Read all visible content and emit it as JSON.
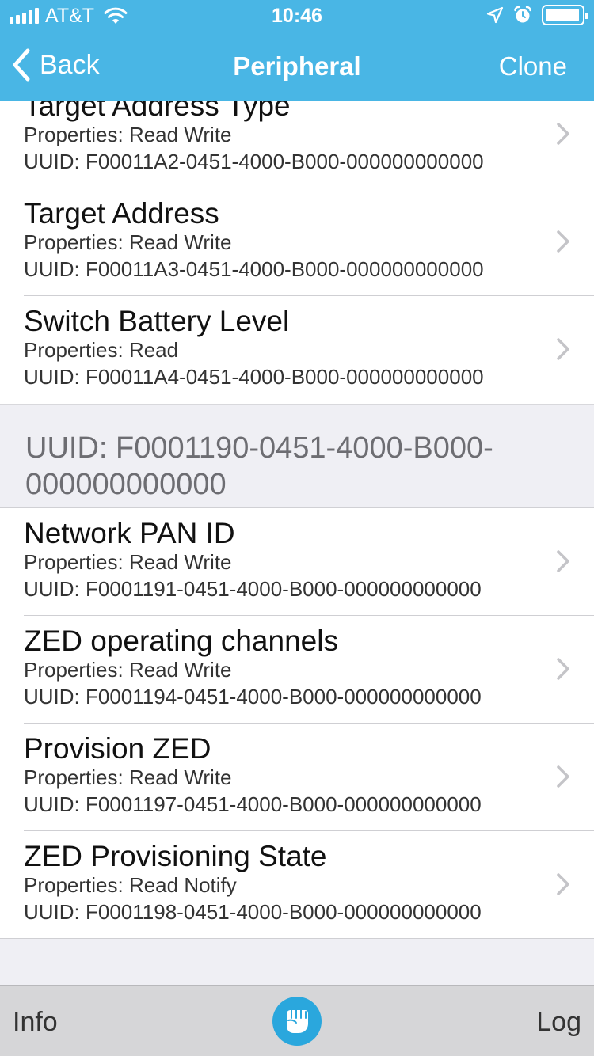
{
  "status_bar": {
    "carrier": "AT&T",
    "time": "10:46",
    "icons": [
      "signal-icon",
      "wifi-icon",
      "location-arrow-icon",
      "alarm-icon",
      "battery-icon"
    ]
  },
  "nav": {
    "back_label": "Back",
    "title": "Peripheral",
    "clone_label": "Clone"
  },
  "characteristics_top": [
    {
      "name": "Target Address Type",
      "properties": "Properties: Read Write",
      "uuid": "UUID: F00011A2-0451-4000-B000-000000000000"
    },
    {
      "name": "Target Address",
      "properties": "Properties: Read Write",
      "uuid": "UUID: F00011A3-0451-4000-B000-000000000000"
    },
    {
      "name": "Switch Battery Level",
      "properties": "Properties: Read",
      "uuid": "UUID: F00011A4-0451-4000-B000-000000000000"
    }
  ],
  "service_header": {
    "text": "UUID: F0001190-0451-4000-B000-000000000000"
  },
  "characteristics_bottom": [
    {
      "name": "Network PAN ID",
      "properties": "Properties: Read Write",
      "uuid": "UUID: F0001191-0451-4000-B000-000000000000"
    },
    {
      "name": "ZED operating channels",
      "properties": "Properties: Read Write",
      "uuid": "UUID: F0001194-0451-4000-B000-000000000000"
    },
    {
      "name": "Provision ZED",
      "properties": "Properties: Read Write",
      "uuid": "UUID: F0001197-0451-4000-B000-000000000000"
    },
    {
      "name": "ZED Provisioning State",
      "properties": "Properties: Read Notify",
      "uuid": "UUID: F0001198-0451-4000-B000-000000000000"
    }
  ],
  "tab_bar": {
    "info_label": "Info",
    "log_label": "Log",
    "logo_icon": "fist-icon"
  },
  "colors": {
    "nav_bar": "#49b6e5",
    "background": "#efeff4",
    "tab_bar": "#d6d6d8",
    "logo_circle": "#2aa7dd"
  }
}
